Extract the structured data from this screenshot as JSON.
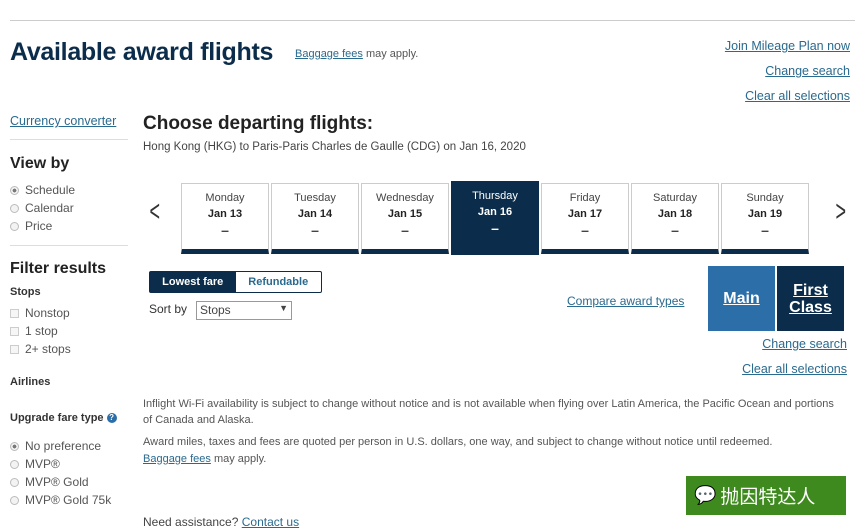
{
  "header": {
    "title": "Available award flights",
    "baggage_link": "Baggage fees",
    "baggage_suffix": " may apply.",
    "join_link": "Join Mileage Plan now",
    "change_search": "Change search",
    "clear_all": "Clear all selections"
  },
  "sidebar": {
    "currency_converter": "Currency converter",
    "view_by": "View by",
    "view_options": [
      "Schedule",
      "Calendar",
      "Price"
    ],
    "filter_results": "Filter results",
    "stops_label": "Stops",
    "stops": [
      "Nonstop",
      "1 stop",
      "2+ stops"
    ],
    "airlines_label": "Airlines",
    "upgrade_label": "Upgrade fare type",
    "upgrade_options": [
      "No preference",
      "MVP®",
      "MVP® Gold",
      "MVP® Gold 75k"
    ]
  },
  "main": {
    "title": "Choose departing flights:",
    "route": "Hong Kong (HKG) to Paris-Paris Charles de Gaulle (CDG) on Jan 16, 2020",
    "days": [
      {
        "dow": "Monday",
        "date": "Jan 13",
        "price": "–"
      },
      {
        "dow": "Tuesday",
        "date": "Jan 14",
        "price": "–"
      },
      {
        "dow": "Wednesday",
        "date": "Jan 15",
        "price": "–"
      },
      {
        "dow": "Thursday",
        "date": "Jan 16",
        "price": "–"
      },
      {
        "dow": "Friday",
        "date": "Jan 17",
        "price": "–"
      },
      {
        "dow": "Saturday",
        "date": "Jan 18",
        "price": "–"
      },
      {
        "dow": "Sunday",
        "date": "Jan 19",
        "price": "–"
      }
    ],
    "selected_day": "Jan 16",
    "fare_toggle": [
      "Lowest fare",
      "Refundable"
    ],
    "sort_label": "Sort by",
    "sort_value": "Stops",
    "compare_link": "Compare award types",
    "cabins": [
      "Main",
      "First Class"
    ],
    "change_search": "Change search",
    "clear_all": "Clear all selections",
    "wifi_note": "Inflight Wi-Fi availability is subject to change without notice and is not available when flying over Latin America, the Pacific Ocean and portions of Canada and Alaska.",
    "award_note": "Award miles, taxes and fees are quoted per person in U.S. dollars, one way, and subject to change without notice until redeemed.",
    "baggage_link": "Baggage fees",
    "baggage_suffix": " may apply.",
    "assist": "Need assistance? ",
    "contact": "Contact us"
  },
  "watermark": "抛因特达人",
  "colors": {
    "navy": "#0b2c4a",
    "main_cabin": "#2b6ea8",
    "link": "#2a6a8e",
    "watermark": "#3f8a1e"
  }
}
